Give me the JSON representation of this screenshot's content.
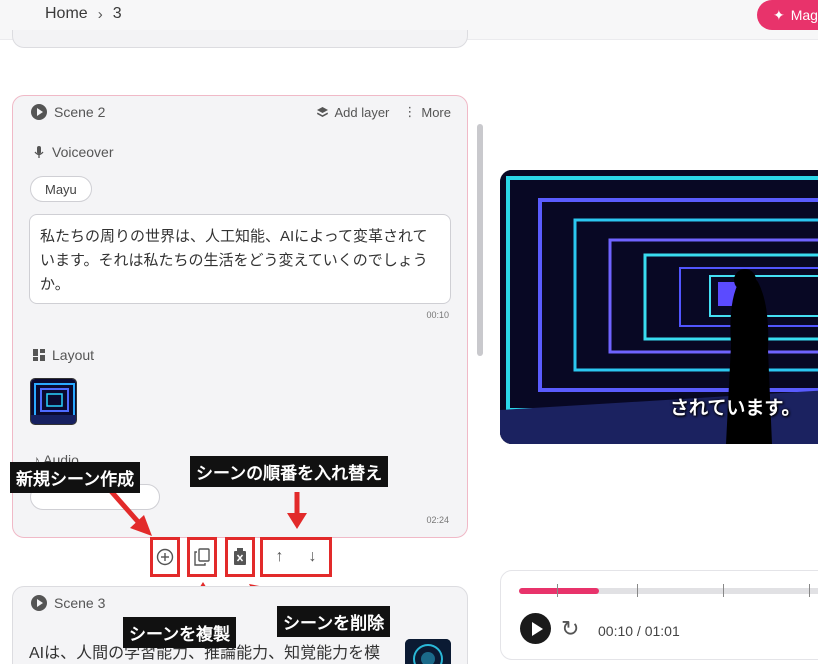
{
  "breadcrumb": {
    "home": "Home",
    "separator": "›",
    "current": "3"
  },
  "header": {
    "magic_label": "Mag"
  },
  "scene2": {
    "title": "Scene 2",
    "add_layer": "Add layer",
    "more": "More",
    "voiceover_label": "Voiceover",
    "voice": "Mayu",
    "script": "私たちの周りの世界は、人工知能、AIによって変革されています。それは私たちの生活をどう変えていくのでしょうか。",
    "script_duration": "00:10",
    "layout_label": "Layout",
    "audio_label": "Audio",
    "scene_duration": "02:24"
  },
  "annotations": {
    "new_scene": "新規シーン作成",
    "reorder": "シーンの順番を入れ替え",
    "duplicate": "シーンを複製",
    "delete": "シーンを削除"
  },
  "scene3": {
    "title": "Scene 3",
    "script_preview": "AIは、人間の学習能力、推論能力、知覚能力を模"
  },
  "preview": {
    "subtitle": "されています。"
  },
  "player": {
    "time": "00:10 / 01:01",
    "progress": 0.25
  },
  "colors": {
    "accent": "#e8336b",
    "annotation_border": "#e22a2a",
    "annotation_bg": "#111111"
  },
  "icons": [
    "chevron-right-icon",
    "sparkle-icon",
    "play-icon",
    "layers-icon",
    "more-vertical-icon",
    "microphone-icon",
    "layout-icon",
    "music-icon",
    "plus-circle-icon",
    "copy-icon",
    "trash-icon",
    "arrow-up-icon",
    "arrow-down-icon",
    "replay-icon"
  ]
}
